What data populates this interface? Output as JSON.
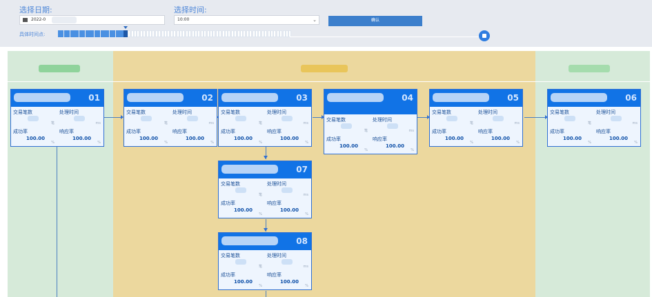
{
  "header": {
    "date_label": "选择日期:",
    "date_value": "2022-0",
    "time_label": "选择时间:",
    "time_value": "10:00",
    "confirm_label": "确认",
    "timepoint_label": "具体时间点:",
    "ticks_total": 77,
    "ticks_filled": 22,
    "tick_current": 23
  },
  "cards": [
    {
      "id": "01",
      "fields": [
        {
          "key": "交易笔数",
          "value": ""
        },
        {
          "key": "处理时间",
          "value": ""
        },
        {
          "key": "成功率",
          "value": "100.00"
        },
        {
          "key": "响应率",
          "value": "100.00"
        }
      ]
    },
    {
      "id": "02",
      "fields": [
        {
          "key": "交易笔数",
          "value": ""
        },
        {
          "key": "处理时间",
          "value": ""
        },
        {
          "key": "成功率",
          "value": "100.00"
        },
        {
          "key": "响应率",
          "value": "100.00"
        }
      ]
    },
    {
      "id": "03",
      "fields": [
        {
          "key": "交易笔数",
          "value": ""
        },
        {
          "key": "处理时间",
          "value": ""
        },
        {
          "key": "成功率",
          "value": "100.00"
        },
        {
          "key": "响应率",
          "value": "100.00"
        }
      ]
    },
    {
      "id": "04",
      "fields": [
        {
          "key": "交易笔数",
          "value": ""
        },
        {
          "key": "处理时间",
          "value": ""
        },
        {
          "key": "成功率",
          "value": "100.00"
        },
        {
          "key": "响应率",
          "value": "100.00"
        }
      ]
    },
    {
      "id": "05",
      "fields": [
        {
          "key": "交易笔数",
          "value": ""
        },
        {
          "key": "处理时间",
          "value": ""
        },
        {
          "key": "成功率",
          "value": "100.00"
        },
        {
          "key": "响应率",
          "value": "100.00"
        }
      ]
    },
    {
      "id": "06",
      "fields": [
        {
          "key": "交易笔数",
          "value": ""
        },
        {
          "key": "处理时间",
          "value": ""
        },
        {
          "key": "成功率",
          "value": "100.00"
        },
        {
          "key": "响应率",
          "value": "100.00"
        }
      ]
    },
    {
      "id": "07",
      "fields": [
        {
          "key": "交易笔数",
          "value": ""
        },
        {
          "key": "处理时间",
          "value": ""
        },
        {
          "key": "成功率",
          "value": "100.00"
        },
        {
          "key": "响应率",
          "value": "100.00"
        }
      ]
    },
    {
      "id": "08",
      "fields": [
        {
          "key": "交易笔数",
          "value": ""
        },
        {
          "key": "处理时间",
          "value": ""
        },
        {
          "key": "成功率",
          "value": "100.00"
        },
        {
          "key": "响应率",
          "value": "100.00"
        }
      ]
    }
  ],
  "units": [
    "笔",
    "ms",
    "%",
    "%"
  ],
  "icons": {
    "calendar": "calendar-icon",
    "dropdown": "chevron-down-icon",
    "play": "stop-icon"
  },
  "colors": {
    "accent": "#1173e6",
    "lane_side": "#d6ead9",
    "lane_mid": "#ecd89e"
  }
}
